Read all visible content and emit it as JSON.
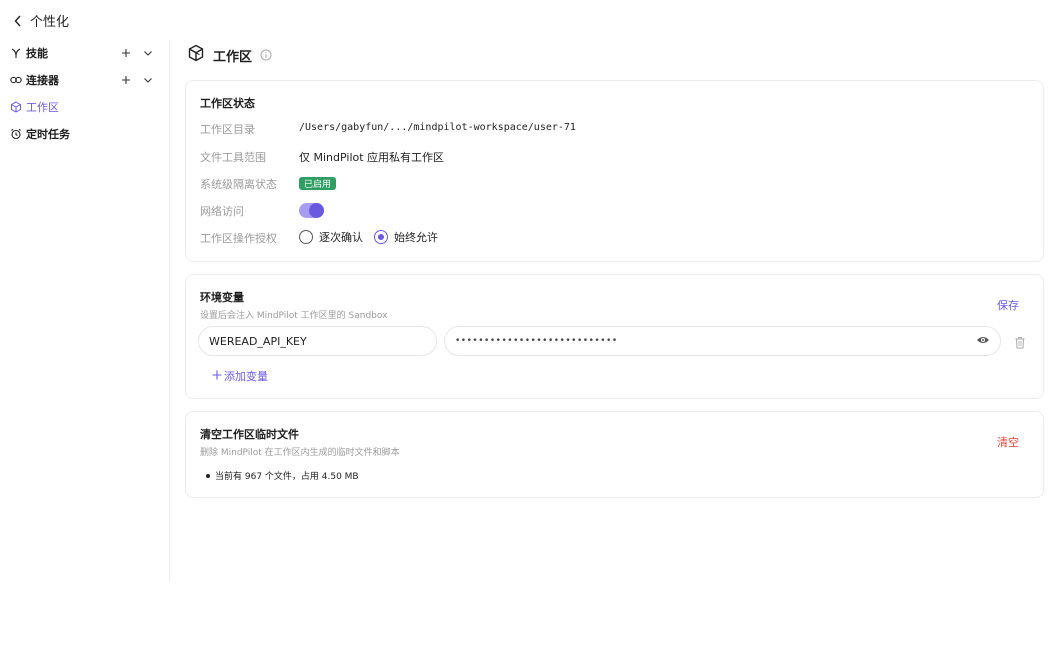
{
  "nav": {
    "back_title": "个性化"
  },
  "sidebar": {
    "items": [
      {
        "label": "技能"
      },
      {
        "label": "连接器"
      },
      {
        "label": "工作区"
      },
      {
        "label": "定时任务"
      }
    ]
  },
  "header": {
    "title": "工作区"
  },
  "status_card": {
    "title": "工作区状态",
    "rows": {
      "dir_label": "工作区目录",
      "dir_value": "/Users/gabyfun/.../mindpilot-workspace/user-71",
      "scope_label": "文件工具范围",
      "scope_value": "仅 MindPilot 应用私有工作区",
      "isolation_label": "系统级隔离状态",
      "isolation_badge": "已启用",
      "network_label": "网络访问",
      "network_enabled": true,
      "auth_label": "工作区操作授权",
      "auth_option_1": "逐次确认",
      "auth_option_2": "始终允许",
      "auth_selected": "始终允许"
    }
  },
  "env_card": {
    "title": "环境变量",
    "subtitle": "设置后会注入 MindPilot 工作区里的 Sandbox",
    "save_label": "保存",
    "key_value": "WEREAD_API_KEY",
    "secret_value": "••••••••••••••••••••••••••••",
    "add_label": "添加变量"
  },
  "clear_card": {
    "title": "清空工作区临时文件",
    "subtitle": "删除 MindPilot 在工作区内生成的临时文件和脚本",
    "clear_label": "清空",
    "info": "当前有 967 个文件，占用 4.50 MB"
  },
  "colors": {
    "accent": "#6a5ae0",
    "success": "#2e9e62",
    "danger": "#e0463a"
  }
}
